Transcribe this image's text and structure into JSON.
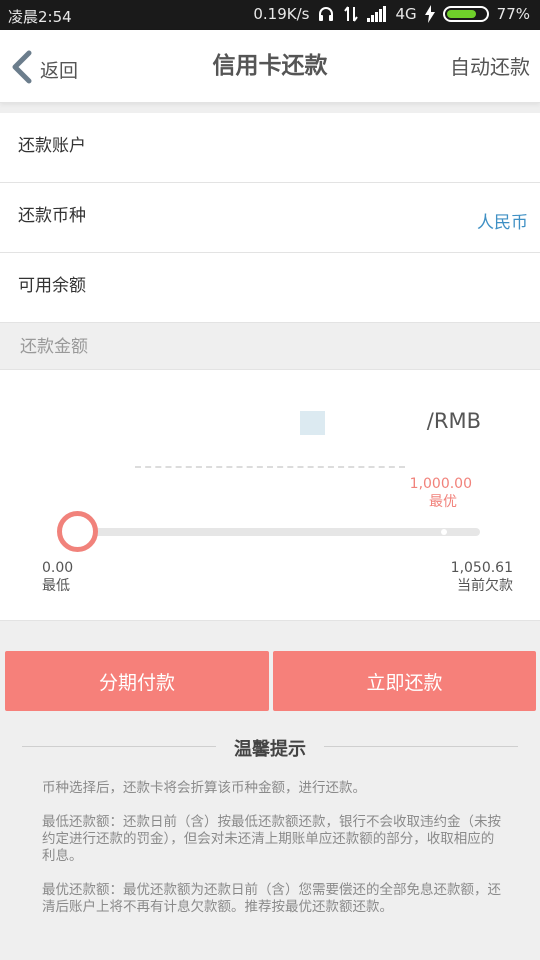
{
  "status_bar": {
    "time": "凌晨2:54",
    "net_speed": "0.19K/s",
    "network": "4G",
    "battery": "77%",
    "battery_level": 0.77
  },
  "nav": {
    "back_label": "返回",
    "title": "信用卡还款",
    "right_action": "自动还款"
  },
  "form": {
    "account_label": "还款账户",
    "currency_label": "还款币种",
    "currency_value": "人民币",
    "balance_label": "可用余额"
  },
  "amount": {
    "section_label": "还款金额",
    "currency_suffix": "/RMB",
    "optimal_value": "1,000.00",
    "optimal_label": "最优",
    "min_value": "0.00",
    "min_label": "最低",
    "max_value": "1,050.61",
    "max_label": "当前欠款",
    "slider_fraction": 0.0
  },
  "buttons": {
    "installment": "分期付款",
    "pay_now": "立即还款"
  },
  "tips": {
    "title": "温馨提示",
    "tip1": "币种选择后，还款卡将会折算该币种金额，进行还款。",
    "tip2": "最低还款额：还款日前（含）按最低还款额还款，银行不会收取违约金（未按约定进行还款的罚金），但会对未还清上期账单应还款额的部分，收取相应的利息。",
    "tip3": "最优还款额：最优还款额为还款日前（含）您需要偿还的全部免息还款额，还清后账户上将不再有计息欠款额。推荐按最优还款额还款。"
  }
}
